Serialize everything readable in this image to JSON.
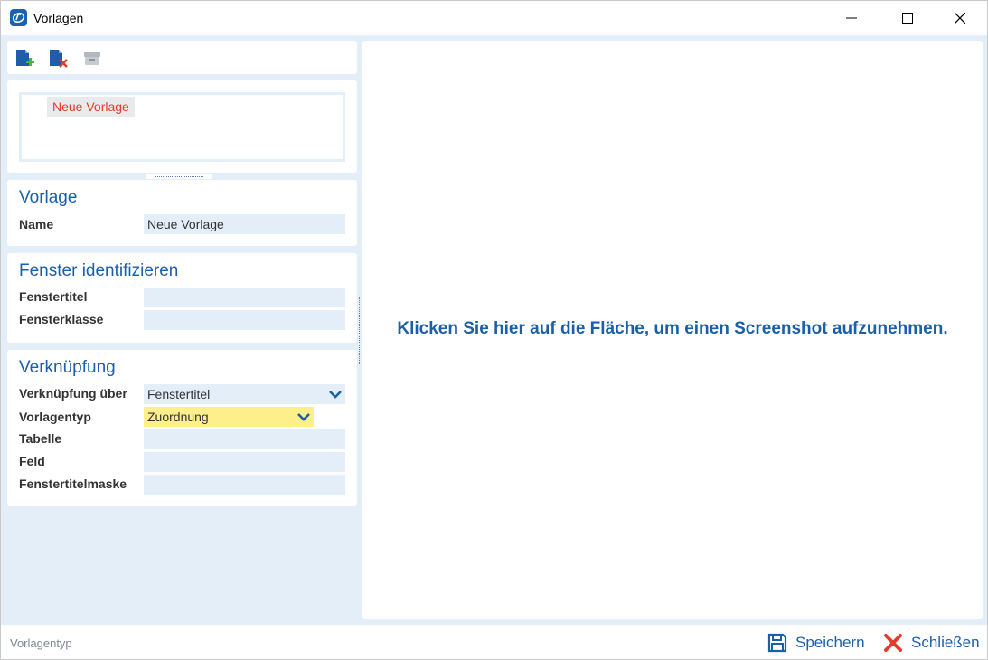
{
  "window": {
    "title": "Vorlagen"
  },
  "templates_list": {
    "items": [
      "Neue Vorlage"
    ]
  },
  "vorlage": {
    "title": "Vorlage",
    "name_label": "Name",
    "name_value": "Neue Vorlage"
  },
  "fenster": {
    "title": "Fenster identifizieren",
    "titel_label": "Fenstertitel",
    "titel_value": "",
    "klasse_label": "Fensterklasse",
    "klasse_value": ""
  },
  "verknuepfung": {
    "title": "Verknüpfung",
    "ueber_label": "Verknüpfung über",
    "ueber_value": "Fenstertitel",
    "typ_label": "Vorlagentyp",
    "typ_value": "Zuordnung",
    "tabelle_label": "Tabelle",
    "tabelle_value": "",
    "feld_label": "Feld",
    "feld_value": "",
    "maske_label": "Fenstertitelmaske",
    "maske_value": ""
  },
  "screenshot": {
    "message": "Klicken Sie hier auf die Fläche, um einen Screenshot aufzunehmen."
  },
  "status": {
    "text": "Vorlagentyp"
  },
  "actions": {
    "save_label": "Speichern",
    "close_label": "Schließen"
  },
  "colors": {
    "accent": "#1c5fa8",
    "background": "#e3eef9",
    "highlight": "#fdf08a",
    "danger": "#e43b2c"
  },
  "icons": {
    "new": "new-document-icon",
    "delete": "delete-document-icon",
    "archive": "archive-icon",
    "save": "floppy-disk-icon",
    "close": "close-x-icon"
  }
}
